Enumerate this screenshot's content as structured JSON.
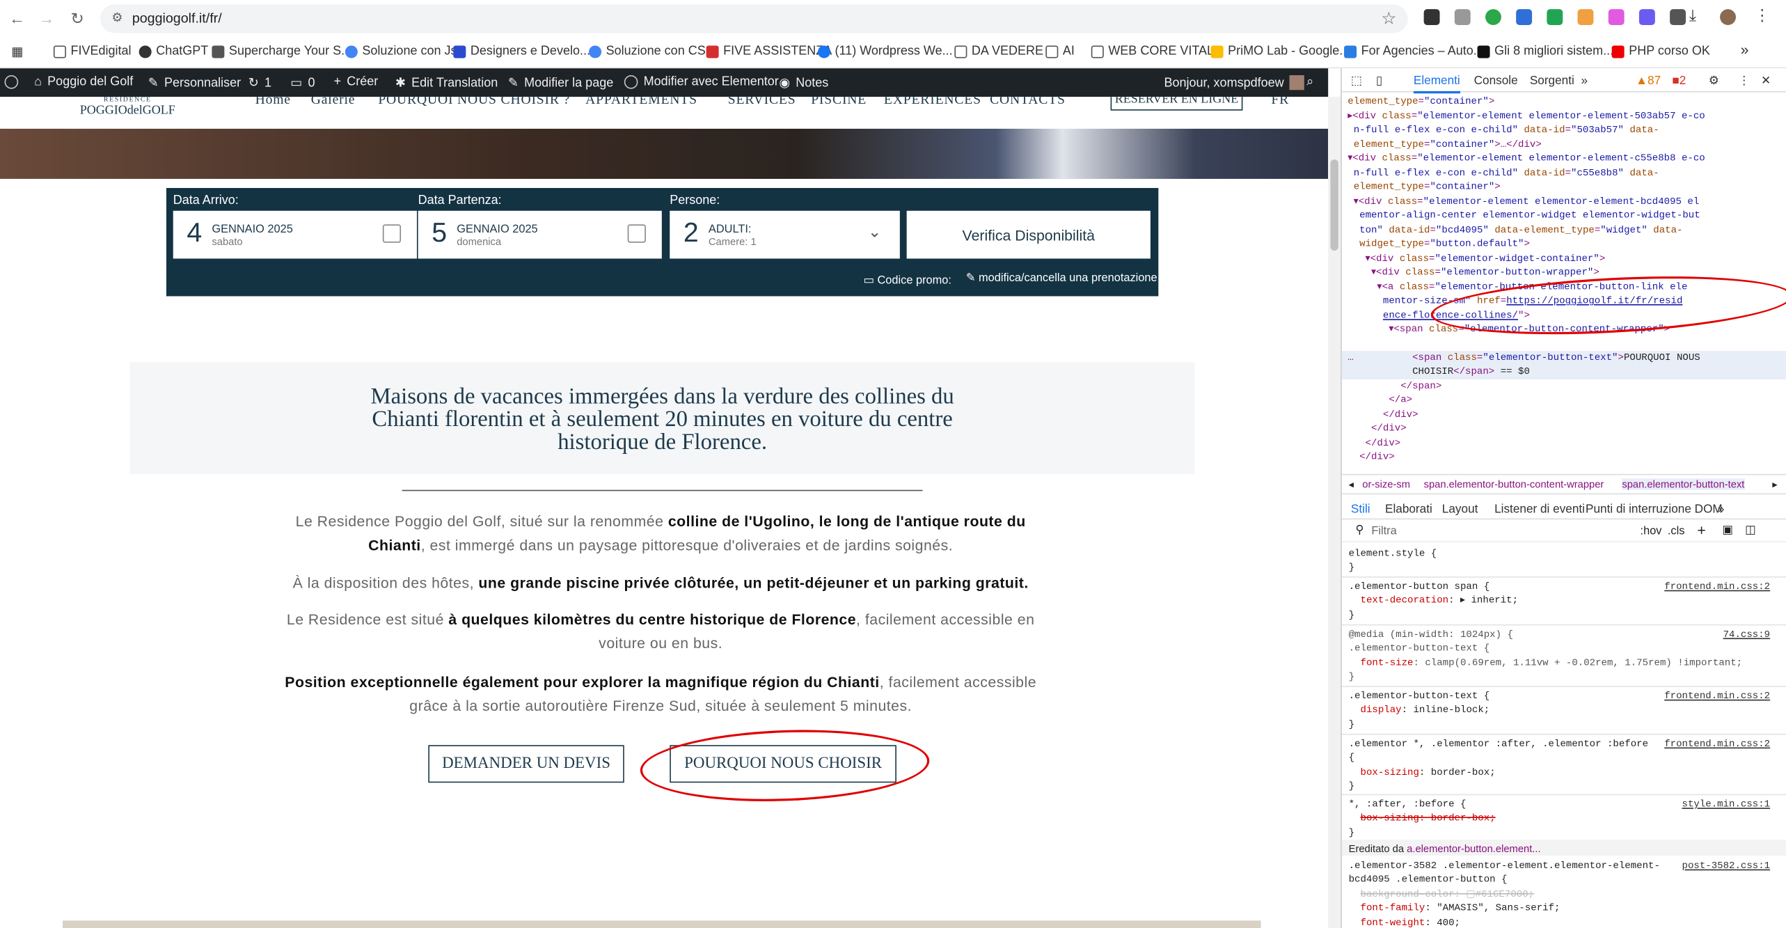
{
  "browser": {
    "url": "poggiogolf.it/fr/"
  },
  "bookmarks": [
    "FIVEdigital",
    "ChatGPT",
    "Supercharge Your S...",
    "Soluzione con Js",
    "Designers e Develo...",
    "Soluzione con CSS",
    "FIVE ASSISTENZA",
    "(11) Wordpress We...",
    "DA VEDERE",
    "AI",
    "WEB CORE VITALS",
    "PriMO Lab - Google...",
    "For Agencies – Auto...",
    "Gli 8 migliori sistem...",
    "PHP corso OK"
  ],
  "wpbar": {
    "site": "Poggio del Golf",
    "customize": "Personnaliser",
    "updates": "1",
    "comments": "0",
    "new": "Créer",
    "translate": "Edit Translation",
    "edit_page": "Modifier la page",
    "elementor": "Modifier avec Elementor",
    "notes": "Notes",
    "greeting": "Bonjour, xomspdfoew"
  },
  "site": {
    "logo_small": "RESIDENCE",
    "logo": "POGGIOdelGOLF",
    "menu": [
      "Home",
      "Galerie",
      "POURQUOI NOUS CHOISIR ?",
      "APPARTEMENTS",
      "SERVICES",
      "PISCINE",
      "EXPERIENCES",
      "CONTACTS"
    ],
    "book_btn": "RÉSERVER EN LIGNE",
    "lang": "FR",
    "booking": {
      "arrival_label": "Data Arrivo:",
      "departure_label": "Data Partenza:",
      "persons_label": "Persone:",
      "arr_day": "4",
      "arr_month": "GENNAIO 2025",
      "arr_weekday": "sabato",
      "dep_day": "5",
      "dep_month": "GENNAIO 2025",
      "dep_weekday": "domenica",
      "persons": "2",
      "adults": "ADULTI:",
      "rooms": "Camere: 1",
      "check": "Verifica Disponibilità",
      "promo": "Codice promo:",
      "modify": "modifica/cancella una prenotazione"
    },
    "intro": "Maisons de vacances immergées dans la verdure des collines du Chianti florentin et à seulement 20 minutes en voiture du centre historique de Florence.",
    "p1a": "Le Residence Poggio del Golf, situé sur la renommée ",
    "p1b": "colline de l'Ugolino, le long de l'antique route du Chianti",
    "p1c": ", est immergé dans un paysage pittoresque d'oliveraies et de jardins soignés.",
    "p2a": "À la disposition des hôtes, ",
    "p2b": "une grande piscine privée clôturée, un petit-déjeuner et un parking gratuit.",
    "p3a": "Le Residence est situé ",
    "p3b": "à quelques kilomètres du centre historique de Florence",
    "p3c": ", facilement accessible en voiture ou en bus.",
    "p4a": "Position exceptionnelle également pour explorer la magnifique région du Chianti",
    "p4b": ", facilement accessible grâce à la sortie autoroutière Firenze Sud, située à seulement 5 minutes.",
    "btn_devis": "DEMANDER UN DEVIS",
    "btn_choisir": "POURQUOI NOUS CHOISIR"
  },
  "devtools": {
    "tabs": [
      "Elementi",
      "Console",
      "Sorgenti"
    ],
    "warnings": "87",
    "errors": "2",
    "crumbs": [
      "or-size-sm",
      "span.elementor-button-content-wrapper",
      "span.elementor-button-text"
    ],
    "style_tabs": [
      "Stili",
      "Elaborati",
      "Layout",
      "Listener di eventi",
      "Punti di interruzione DOM"
    ],
    "filter": "Filtra",
    "hov": ":hov",
    ".cls": ".cls",
    "inherited": "Ereditato da",
    "inherited_el": "a.elementor-button.element...",
    "link": "https://poggiogolf.it/fr/residence-florence-collines/"
  }
}
